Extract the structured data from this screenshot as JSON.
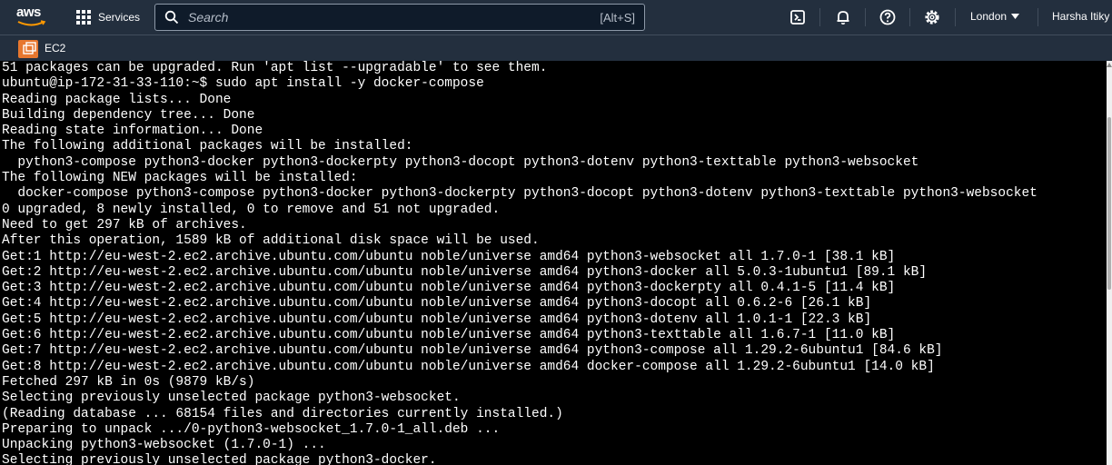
{
  "topnav": {
    "logo_text": "aws",
    "services_label": "Services",
    "search_placeholder": "Search",
    "search_shortcut": "[Alt+S]",
    "region_label": "London",
    "user_label": "Harsha Itiky"
  },
  "subnav": {
    "service_label": "EC2"
  },
  "terminal": {
    "lines": [
      "51 packages can be upgraded. Run 'apt list --upgradable' to see them.",
      "ubuntu@ip-172-31-33-110:~$ sudo apt install -y docker-compose",
      "Reading package lists... Done",
      "Building dependency tree... Done",
      "Reading state information... Done",
      "The following additional packages will be installed:",
      "  python3-compose python3-docker python3-dockerpty python3-docopt python3-dotenv python3-texttable python3-websocket",
      "The following NEW packages will be installed:",
      "  docker-compose python3-compose python3-docker python3-dockerpty python3-docopt python3-dotenv python3-texttable python3-websocket",
      "0 upgraded, 8 newly installed, 0 to remove and 51 not upgraded.",
      "Need to get 297 kB of archives.",
      "After this operation, 1589 kB of additional disk space will be used.",
      "Get:1 http://eu-west-2.ec2.archive.ubuntu.com/ubuntu noble/universe amd64 python3-websocket all 1.7.0-1 [38.1 kB]",
      "Get:2 http://eu-west-2.ec2.archive.ubuntu.com/ubuntu noble/universe amd64 python3-docker all 5.0.3-1ubuntu1 [89.1 kB]",
      "Get:3 http://eu-west-2.ec2.archive.ubuntu.com/ubuntu noble/universe amd64 python3-dockerpty all 0.4.1-5 [11.4 kB]",
      "Get:4 http://eu-west-2.ec2.archive.ubuntu.com/ubuntu noble/universe amd64 python3-docopt all 0.6.2-6 [26.1 kB]",
      "Get:5 http://eu-west-2.ec2.archive.ubuntu.com/ubuntu noble/universe amd64 python3-dotenv all 1.0.1-1 [22.3 kB]",
      "Get:6 http://eu-west-2.ec2.archive.ubuntu.com/ubuntu noble/universe amd64 python3-texttable all 1.6.7-1 [11.0 kB]",
      "Get:7 http://eu-west-2.ec2.archive.ubuntu.com/ubuntu noble/universe amd64 python3-compose all 1.29.2-6ubuntu1 [84.6 kB]",
      "Get:8 http://eu-west-2.ec2.archive.ubuntu.com/ubuntu noble/universe amd64 docker-compose all 1.29.2-6ubuntu1 [14.0 kB]",
      "Fetched 297 kB in 0s (9879 kB/s)",
      "Selecting previously unselected package python3-websocket.",
      "(Reading database ... 68154 files and directories currently installed.)",
      "Preparing to unpack .../0-python3-websocket_1.7.0-1_all.deb ...",
      "Unpacking python3-websocket (1.7.0-1) ...",
      "Selecting previously unselected package python3-docker."
    ]
  },
  "icons": {
    "cloudshell": "cloudshell-icon",
    "notifications": "bell-icon",
    "help": "help-icon",
    "settings": "gear-icon"
  },
  "colors": {
    "nav_bg": "#232f3e",
    "terminal_bg": "#000000",
    "terminal_fg": "#ffffff",
    "accent_orange": "#e7772e"
  }
}
